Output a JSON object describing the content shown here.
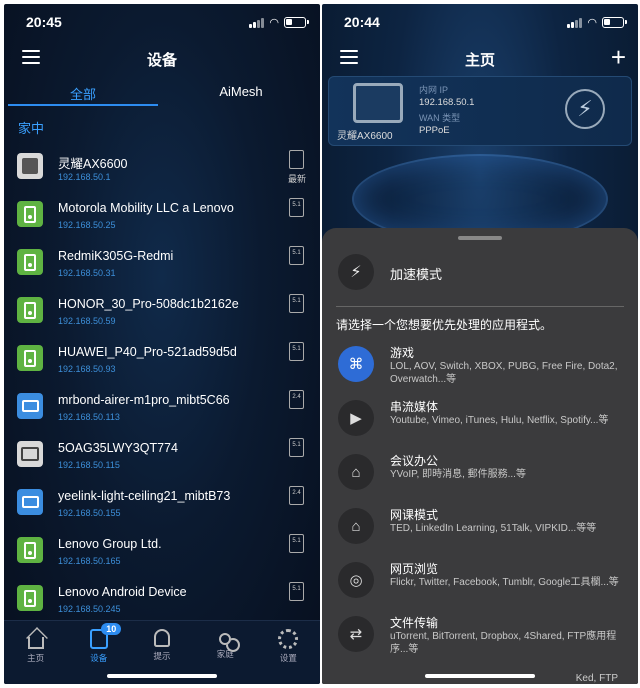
{
  "left": {
    "status_time": "20:45",
    "title": "设备",
    "tabs": [
      {
        "label": "全部"
      },
      {
        "label": "AiMesh"
      }
    ],
    "section": "家中",
    "devices": [
      {
        "name": "灵耀AX6600",
        "ip": "192.168.50.1",
        "icon": "router-icon",
        "badge": "",
        "badge_label": "最新"
      },
      {
        "name": "Motorola Mobility LLC  a Lenovo",
        "ip": "192.168.50.25",
        "icon": "phone-icon",
        "badge": "5.1"
      },
      {
        "name": "RedmiK305G-Redmi",
        "ip": "192.168.50.31",
        "icon": "phone-icon",
        "badge": "5.1"
      },
      {
        "name": "HONOR_30_Pro-508dc1b2162e",
        "ip": "192.168.50.59",
        "icon": "phone-icon",
        "badge": "5.1"
      },
      {
        "name": "HUAWEI_P40_Pro-521ad59d5d",
        "ip": "192.168.50.93",
        "icon": "phone-icon",
        "badge": "5.1"
      },
      {
        "name": "mrbond-airer-m1pro_mibt5C66",
        "ip": "192.168.50.113",
        "icon": "laptop-icon",
        "badge": "2.4"
      },
      {
        "name": "5OAG35LWY3QT774",
        "ip": "192.168.50.115",
        "icon": "tv-icon",
        "badge": "5.1"
      },
      {
        "name": "yeelink-light-ceiling21_mibtB73",
        "ip": "192.168.50.155",
        "icon": "laptop-icon",
        "badge": "2.4"
      },
      {
        "name": "Lenovo Group Ltd.",
        "ip": "192.168.50.165",
        "icon": "phone-icon",
        "badge": "5.1"
      },
      {
        "name": "Lenovo Android Device",
        "ip": "192.168.50.245",
        "icon": "phone-icon",
        "badge": "5.1"
      }
    ],
    "tabbar": [
      {
        "label": "主页",
        "icon": "home-icon"
      },
      {
        "label": "设备",
        "icon": "devices-icon",
        "count": "10"
      },
      {
        "label": "提示",
        "icon": "bell-icon"
      },
      {
        "label": "家庭",
        "icon": "family-icon"
      },
      {
        "label": "设置",
        "icon": "gear-icon"
      }
    ]
  },
  "right": {
    "status_time": "20:44",
    "title": "主页",
    "router_name": "灵耀AX6600",
    "lan_ip_label": "内网 IP",
    "lan_ip": "192.168.50.1",
    "wan_label": "WAN 类型",
    "wan_type": "PPPoE",
    "mode_label": "加速模式",
    "prompt": "请选择一个您想要优先处理的应用程式。",
    "apps": [
      {
        "title": "游戏",
        "desc": "LOL, AOV, Switch, XBOX, PUBG, Free Fire, Dota2, Overwatch...等",
        "icon": "gamepad-icon"
      },
      {
        "title": "串流媒体",
        "desc": "Youtube, Vimeo, iTunes, Hulu, Netflix, Spotify...等",
        "icon": "play-icon"
      },
      {
        "title": "会议办公",
        "desc": "YVoIP, 即時消息, 郵件服務...等",
        "icon": "office-icon"
      },
      {
        "title": "网课模式",
        "desc": "TED, LinkedIn Learning, 51Talk, VIPKID...等等",
        "icon": "school-icon"
      },
      {
        "title": "网页浏览",
        "desc": "Flickr, Twitter, Facebook, Tumblr, Google工具欄...等",
        "icon": "globe-icon"
      },
      {
        "title": "文件传输",
        "desc": "uTorrent, BitTorrent, Dropbox, 4Shared, FTP應用程序...等",
        "icon": "transfer-icon"
      }
    ],
    "tail": "Ked, FTP"
  }
}
